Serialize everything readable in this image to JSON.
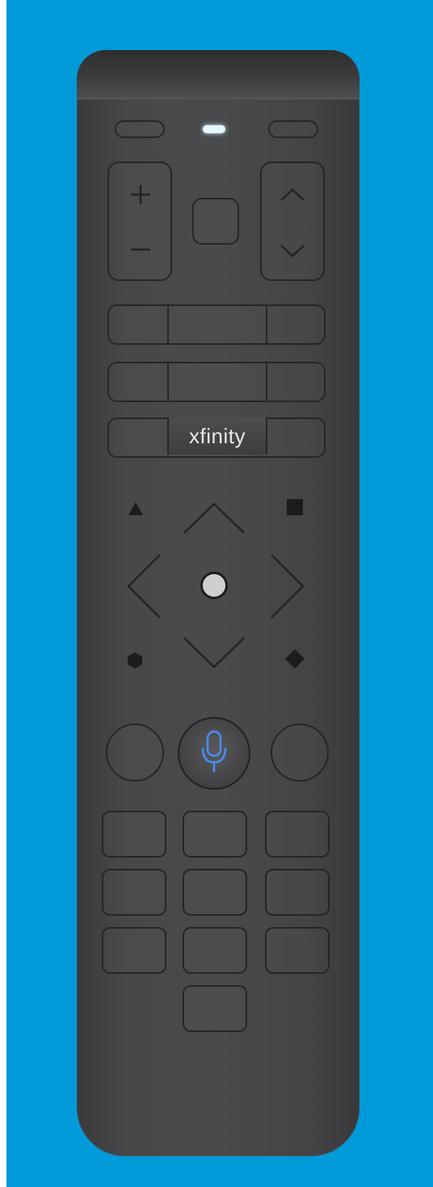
{
  "colors": {
    "background": "#009ad8",
    "remote_body": "#48484a",
    "led": "#e6f6ff",
    "mic_accent": "#4a8dff"
  },
  "remote": {
    "brand_label": "xfinity",
    "buttons": {
      "top_left": "",
      "top_right": "",
      "volume_up_icon": "plus-icon",
      "volume_down_icon": "minus-icon",
      "channel_up_icon": "chevron-up-icon",
      "channel_down_icon": "chevron-down-icon",
      "voice_icon": "microphone-icon"
    }
  }
}
